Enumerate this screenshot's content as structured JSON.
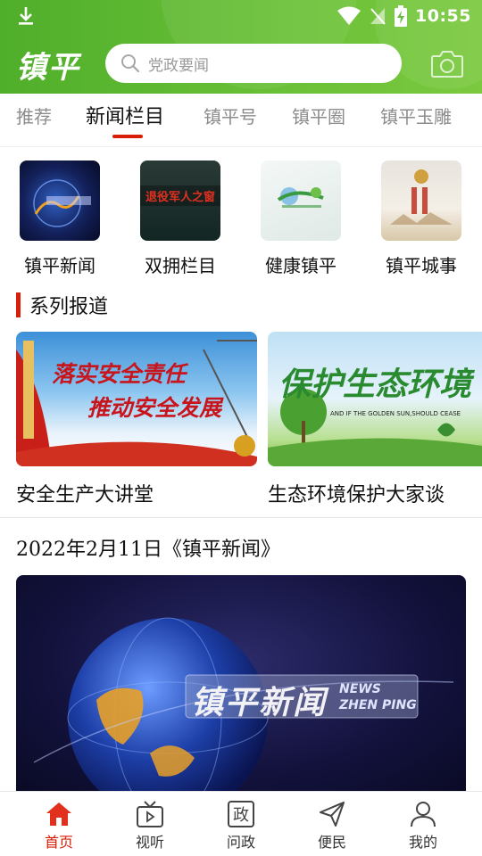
{
  "status_bar": {
    "time": "10:55"
  },
  "app_bar": {
    "logo": "镇平",
    "search_placeholder": "党政要闻"
  },
  "tabs": [
    {
      "label": "推荐"
    },
    {
      "label": "新闻栏目",
      "active": true
    },
    {
      "label": "镇平号"
    },
    {
      "label": "镇平圈"
    },
    {
      "label": "镇平玉雕"
    }
  ],
  "channels": [
    {
      "label": "镇平新闻"
    },
    {
      "label": "双拥栏目",
      "thumb_text": "退役军人之窗"
    },
    {
      "label": "健康镇平"
    },
    {
      "label": "镇平城事"
    }
  ],
  "series": {
    "title": "系列报道",
    "items": [
      {
        "label": "安全生产大讲堂",
        "banner_line1": "落实安全责任",
        "banner_line2": "推动安全发展"
      },
      {
        "label": "生态环境保护大家谈",
        "banner_title": "保护生态环境",
        "banner_sub": "AND IF THE GOLDEN SUN,SHOULD CEASE"
      }
    ]
  },
  "news": {
    "title": "2022年2月11日《镇平新闻》",
    "video_title": "镇平新闻",
    "video_en1": "NEWS",
    "video_en2": "ZHEN PING"
  },
  "bottom_nav": [
    {
      "label": "首页",
      "icon": "home-icon",
      "active": true
    },
    {
      "label": "视听",
      "icon": "tv-icon"
    },
    {
      "label": "问政",
      "icon": "politics-icon"
    },
    {
      "label": "便民",
      "icon": "send-icon"
    },
    {
      "label": "我的",
      "icon": "user-icon"
    }
  ],
  "colors": {
    "accent": "#d81e06",
    "header_green": "#5cb830"
  }
}
